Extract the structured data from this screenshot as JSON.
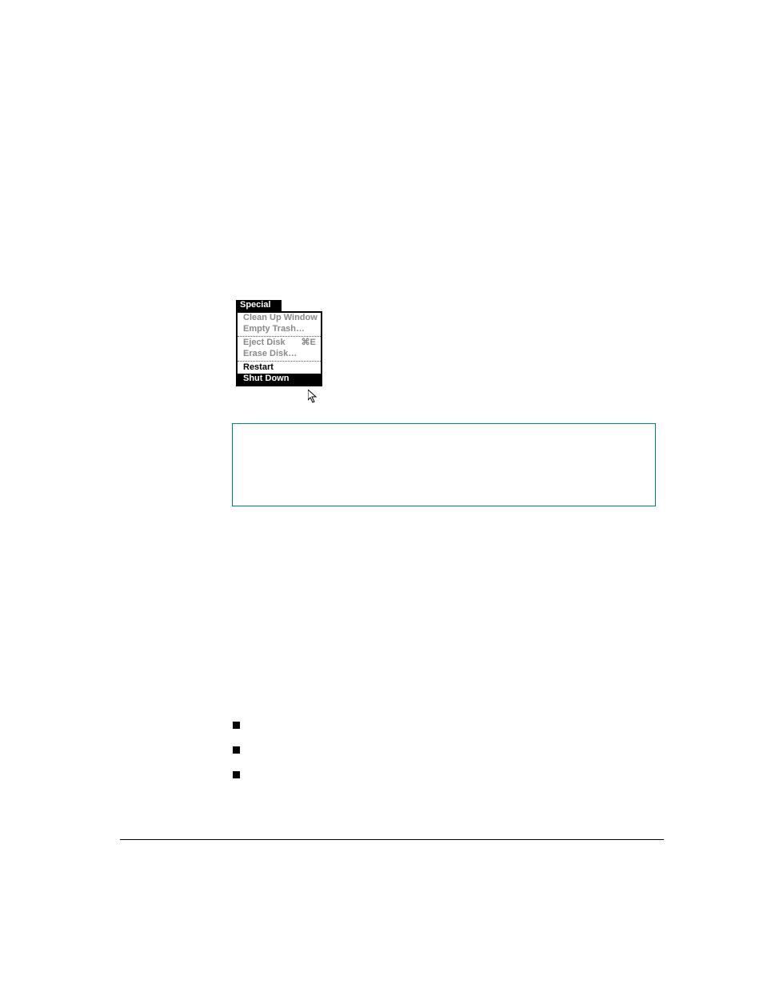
{
  "menu": {
    "title": "Special",
    "items": [
      {
        "label": "Clean Up Window",
        "disabled": true
      },
      {
        "label": "Empty Trash…",
        "disabled": true
      },
      {
        "sep": true
      },
      {
        "label": "Eject Disk",
        "disabled": true,
        "shortcut": "⌘E"
      },
      {
        "label": "Erase Disk…",
        "disabled": true
      },
      {
        "sep": true
      },
      {
        "label": "Restart",
        "disabled": false
      },
      {
        "label": "Shut Down",
        "disabled": false,
        "selected": true
      }
    ]
  },
  "bullets": [
    "",
    "",
    ""
  ]
}
